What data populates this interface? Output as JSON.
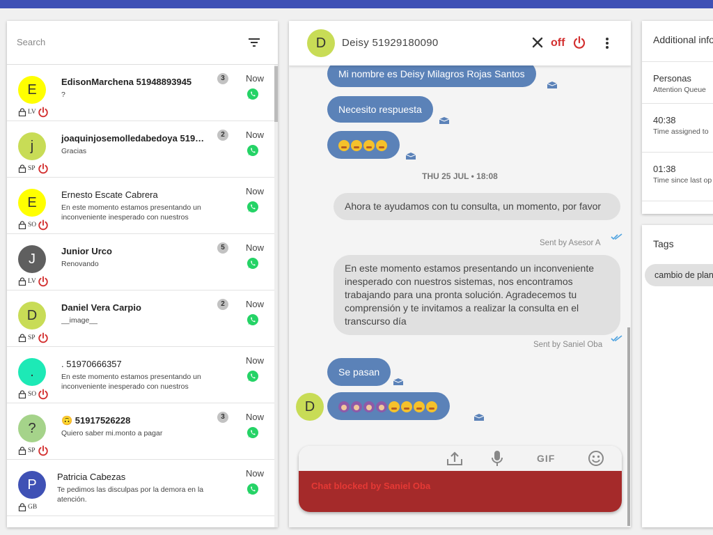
{
  "search": {
    "placeholder": "Search"
  },
  "conversations": [
    {
      "initial": "E",
      "avatar_color": "#ffff00",
      "avatar_text_color": "#333333",
      "name": "EdisonMarchena 51948893945",
      "bold": true,
      "preview": "?",
      "badge": "3",
      "time": "Now",
      "queue": "LV",
      "power_on": true
    },
    {
      "initial": "j",
      "avatar_color": "#c8dc56",
      "avatar_text_color": "#333333",
      "name": "joaquinjosemolledabedoya 51960…",
      "bold": true,
      "preview": "Gracias",
      "badge": "2",
      "time": "Now",
      "queue": "SP",
      "power_on": true
    },
    {
      "initial": "E",
      "avatar_color": "#ffff00",
      "avatar_text_color": "#333333",
      "name": "Ernesto Escate Cabrera",
      "bold": false,
      "preview": "En este momento estamos presentando un inconveniente inesperado con nuestros sistemas, nos encontramos trabajando para",
      "badge": "",
      "time": "Now",
      "queue": "SO",
      "power_on": true
    },
    {
      "initial": "J",
      "avatar_color": "#5f5f5f",
      "avatar_text_color": "#ffffff",
      "name": "Junior Urco",
      "bold": true,
      "preview": "Renovando",
      "badge": "5",
      "time": "Now",
      "queue": "LV",
      "power_on": true
    },
    {
      "initial": "D",
      "avatar_color": "#c8dc56",
      "avatar_text_color": "#333333",
      "name": "Daniel Vera Carpio",
      "bold": true,
      "preview": "__image__",
      "badge": "2",
      "time": "Now",
      "queue": "SP",
      "power_on": true
    },
    {
      "initial": ".",
      "avatar_color": "#1de9b6",
      "avatar_text_color": "#333333",
      "name": ". 51970666357",
      "bold": false,
      "preview": "En este momento estamos presentando un inconveniente inesperado con nuestros sistemas, nos encontramos trabajando para",
      "badge": "",
      "time": "Now",
      "queue": "SO",
      "power_on": true
    },
    {
      "initial": "?",
      "avatar_color": "#a5d38a",
      "avatar_text_color": "#333333",
      "name": "🙃 51917526228",
      "bold": true,
      "preview": "Quiero saber mi.monto a pagar",
      "badge": "3",
      "time": "Now",
      "queue": "SP",
      "power_on": true
    },
    {
      "initial": "P",
      "avatar_color": "#3f51b5",
      "avatar_text_color": "#ffffff",
      "name": "Patricia Cabezas",
      "bold": false,
      "preview": "Te pedimos las disculpas por la demora en la atención.",
      "badge": "",
      "time": "Now",
      "queue": "GB",
      "power_on": false
    }
  ],
  "chat": {
    "initial": "D",
    "title": "Deisy 51929180090",
    "status_label": "off",
    "messages": {
      "m1": "Mi nombre es Deisy Milagros Rojas Santos",
      "m2": "Necesito respuesta",
      "date": "THU 25 JUL • 18:08",
      "m3": "Ahora te ayudamos con tu consulta, un momento, por favor",
      "m3_sender": "Sent by Asesor A",
      "m4": "En este momento estamos presentando un inconveniente inesperado con nuestros sistemas, nos encontramos trabajando para una pronta solución. Agradecemos tu comprensión y te invitamos a realizar la consulta en el transcurso día",
      "m4_sender": "Sent by Saniel Oba",
      "m5": "Se pasan"
    },
    "blocked_text": "Chat blocked by Saniel Oba",
    "gif_label": "GIF"
  },
  "info": {
    "header": "Additional info",
    "rows": [
      {
        "value": "Personas",
        "label": "Attention Queue"
      },
      {
        "value": "40:38",
        "label": "Time assigned to"
      },
      {
        "value": "01:38",
        "label": "Time since last op"
      }
    ]
  },
  "tags": {
    "header": "Tags",
    "chip": "cambio de plan"
  },
  "colors": {
    "accent": "#3f51b5",
    "incoming_bubble": "#5b82b8",
    "outgoing_bubble": "#e0e0e0",
    "danger": "#d32f2f",
    "blocked_bar": "#a52a2a",
    "whatsapp": "#25d366"
  }
}
